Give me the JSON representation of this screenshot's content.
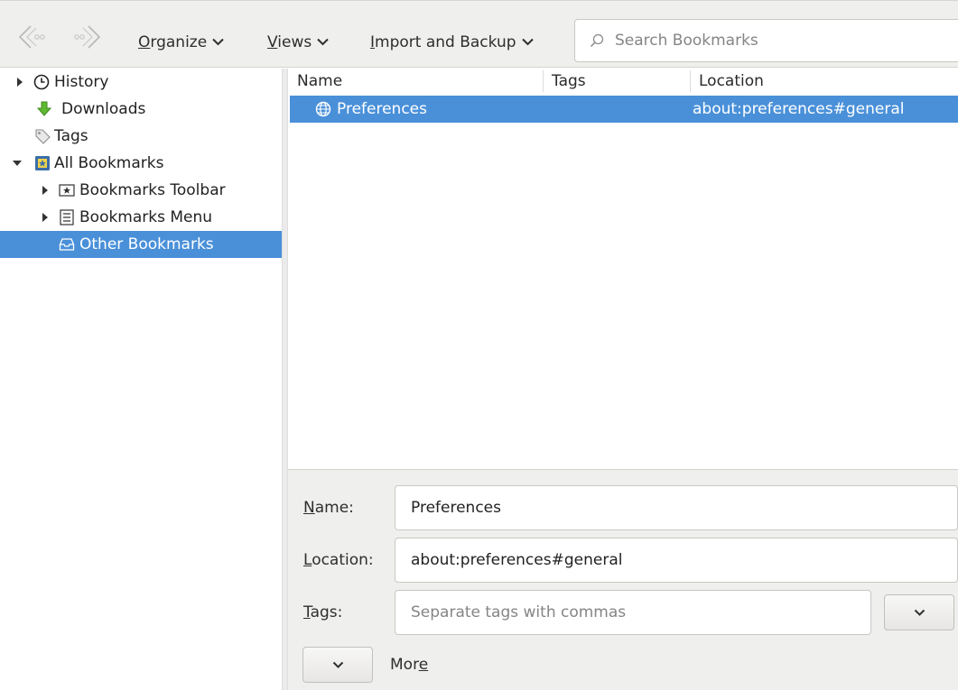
{
  "toolbar": {
    "back_icon": "back-arrow-icon",
    "forward_icon": "forward-arrow-icon",
    "menus": [
      {
        "label": "Organize",
        "accel": "O",
        "rest": "rganize"
      },
      {
        "label": "Views",
        "accel": "V",
        "rest": "iews"
      },
      {
        "label": "Import and Backup",
        "accel": "I",
        "rest": "mport and Backup"
      }
    ],
    "search": {
      "placeholder": "Search Bookmarks",
      "value": ""
    }
  },
  "sidebar": {
    "items": [
      {
        "label": "History",
        "icon": "clock-icon",
        "expandable": true,
        "expanded": false
      },
      {
        "label": "Downloads",
        "icon": "download-arrow-icon"
      },
      {
        "label": "Tags",
        "icon": "tag-icon"
      },
      {
        "label": "All Bookmarks",
        "icon": "bookmarks-library-icon",
        "expandable": true,
        "expanded": true
      },
      {
        "label": "Bookmarks Toolbar",
        "icon": "toolbar-star-icon",
        "expandable": true,
        "expanded": false
      },
      {
        "label": "Bookmarks Menu",
        "icon": "menu-list-icon",
        "expandable": true,
        "expanded": false
      },
      {
        "label": "Other Bookmarks",
        "icon": "folder-tray-icon",
        "selected": true
      }
    ]
  },
  "table": {
    "columns": [
      "Name",
      "Tags",
      "Location"
    ],
    "rows": [
      {
        "name": "Preferences",
        "tags": "",
        "location": "about:preferences#general",
        "icon": "globe-icon",
        "selected": true
      }
    ]
  },
  "details": {
    "name_label": {
      "accel": "N",
      "rest": "ame:"
    },
    "location_label": {
      "accel": "L",
      "rest": "ocation:"
    },
    "tags_label": {
      "accel": "T",
      "rest": "ags:"
    },
    "name_value": "Preferences",
    "location_value": "about:preferences#general",
    "tags_placeholder": "Separate tags with commas",
    "tags_value": "",
    "more_label": {
      "prefix": "Mor",
      "accel": "e"
    }
  },
  "colors": {
    "selection": "#4a90d9",
    "toolbar_bg": "#efefed",
    "downloads_icon": "#5fb832",
    "bookmarks_icon": "#3b6ea8"
  }
}
